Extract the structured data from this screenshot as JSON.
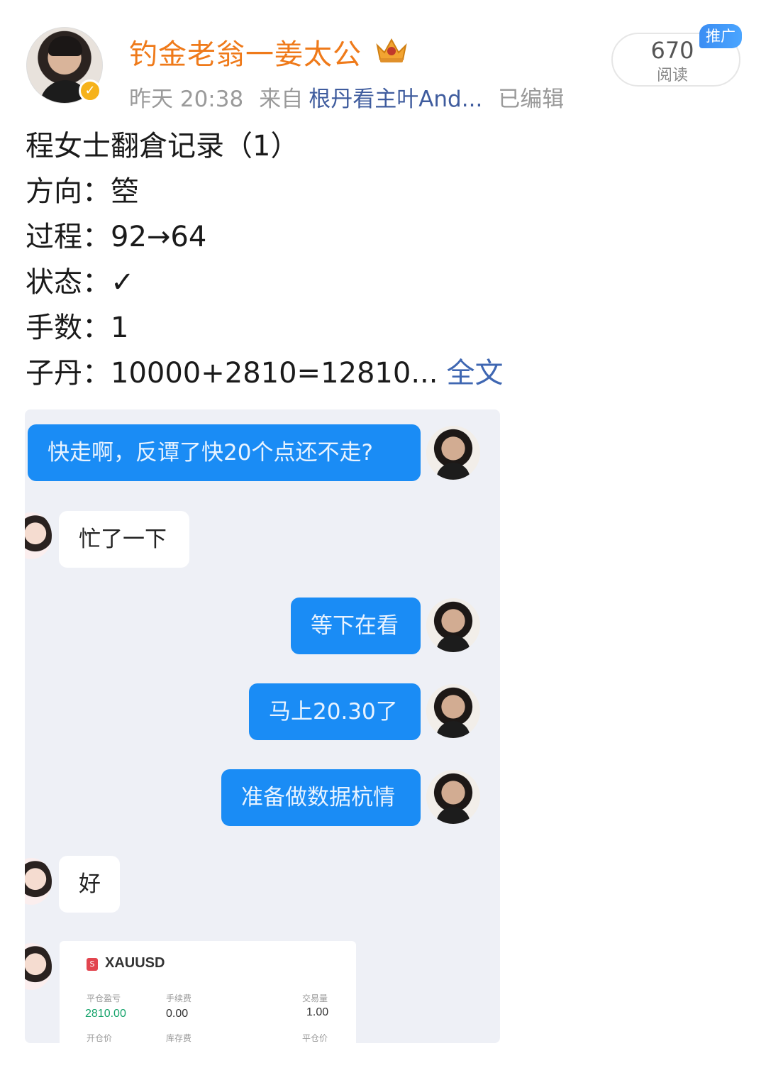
{
  "author": {
    "name": "钓金老翁一姜太公",
    "verified_icon": "verified-v-badge",
    "vip_icon": "crown-badge-icon"
  },
  "meta": {
    "time": "昨天 20:38",
    "source_prefix": "来自",
    "source": "根丹看主叶And...",
    "edited": "已编辑"
  },
  "reads": {
    "count": "670",
    "label": "阅读",
    "promo_badge": "推广"
  },
  "post": {
    "lines": [
      "程女士翻倉记录（1）",
      "方向：箜",
      "过程：92→64",
      "状态：✓",
      "手数：1",
      "子丹：10000+2810=12810..."
    ],
    "full_text_link": "全文"
  },
  "chat": {
    "messages": [
      {
        "side": "out",
        "text": "快走啊，反谭了快20个点还不走?"
      },
      {
        "side": "in",
        "text": "忙了一下"
      },
      {
        "side": "out",
        "text": "等下在看"
      },
      {
        "side": "out",
        "text": "马上20.30了"
      },
      {
        "side": "out",
        "text": "准备做数据杭情"
      },
      {
        "side": "in",
        "text": "好"
      }
    ],
    "receipt": {
      "logo": "S",
      "symbol": "XAUUSD",
      "labels": [
        "平仓盈亏",
        "手续费",
        "交易量",
        "开仓价",
        "库存费",
        "平仓价"
      ],
      "pnl": "2810.00",
      "fee": "0.00",
      "volume": "1.00"
    }
  },
  "colors": {
    "username": "#ef7a1a",
    "link": "#3f67b2",
    "bubble_out": "#1a8cf5",
    "chat_bg": "#eef0f6"
  }
}
